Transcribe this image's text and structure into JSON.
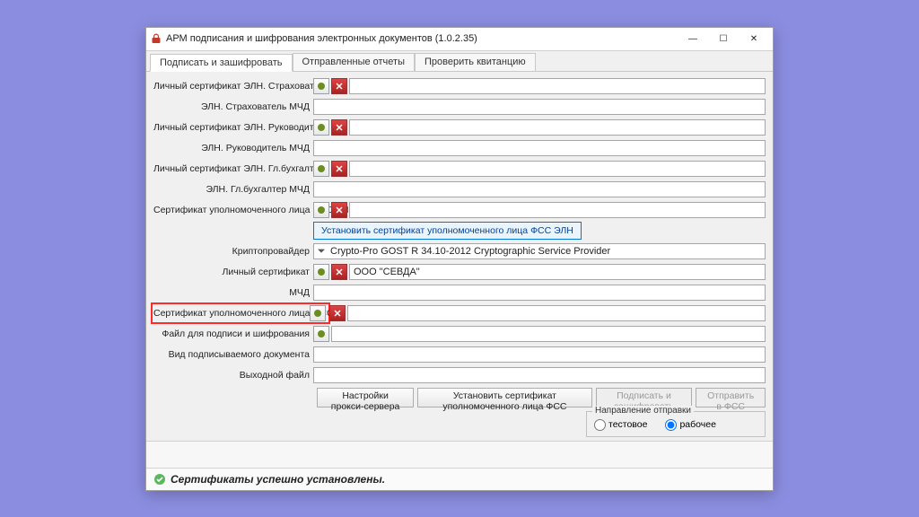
{
  "window": {
    "title": "АРМ подписания и шифрования электронных документов (1.0.2.35)"
  },
  "tabs": [
    {
      "label": "Подписать и зашифровать",
      "active": true
    },
    {
      "label": "Отправленные отчеты",
      "active": false
    },
    {
      "label": "Проверить квитанцию",
      "active": false
    }
  ],
  "fields": {
    "eln_cert_strakh": {
      "label": "Личный сертификат ЭЛН. Страхователь",
      "value": ""
    },
    "eln_strakh_mchd": {
      "label": "ЭЛН. Страхователь МЧД",
      "value": ""
    },
    "eln_cert_ruk": {
      "label": "Личный сертификат ЭЛН. Руководитель",
      "value": ""
    },
    "eln_ruk_mchd": {
      "label": "ЭЛН. Руководитель МЧД",
      "value": ""
    },
    "eln_cert_glbukh": {
      "label": "Личный сертификат ЭЛН. Гл.бухгалтер",
      "value": ""
    },
    "eln_glbukh_mchd": {
      "label": "ЭЛН. Гл.бухгалтер МЧД",
      "value": ""
    },
    "fss_auth_cert_eln": {
      "label": "Сертификат уполномоченного лица ФСС ЭЛН",
      "value": ""
    },
    "install_fss_eln_btn": "Установить сертификат уполномоченного лица ФСС ЭЛН",
    "cryptoprovider": {
      "label": "Криптопровайдер",
      "value": "Crypto-Pro GOST R 34.10-2012 Cryptographic Service Provider"
    },
    "personal_cert": {
      "label": "Личный сертификат",
      "value": "ООО \"СЕВДА\""
    },
    "mchd": {
      "label": "МЧД",
      "value": ""
    },
    "fss_auth_cert": {
      "label": "Сертификат уполномоченного лица ФСС",
      "value": ""
    },
    "file_sign_encrypt": {
      "label": "Файл для подписи и шифрования",
      "value": ""
    },
    "doc_type": {
      "label": "Вид подписываемого документа",
      "value": ""
    },
    "output_file": {
      "label": "Выходной файл",
      "value": ""
    }
  },
  "buttons": {
    "proxy": "Настройки прокси-сервера",
    "install_fss": "Установить сертификат уполномоченного лица ФСС",
    "sign_encrypt": "Подписать и зашифровать",
    "send_fss": "Отправить в ФСС"
  },
  "send_direction": {
    "group_label": "Направление отправки",
    "test": "тестовое",
    "prod": "рабочее",
    "selected": "prod"
  },
  "status": {
    "text": "Сертификаты успешно установлены."
  },
  "colors": {
    "background": "#8b8de0",
    "highlight": "#ff2a2a",
    "link_border": "#0078d7"
  }
}
